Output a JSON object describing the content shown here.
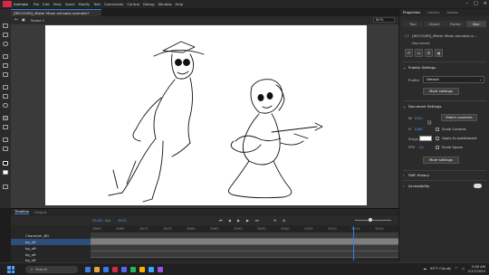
{
  "menubar": {
    "app_name": "Animate",
    "items": [
      "File",
      "Edit",
      "View",
      "Insert",
      "Modify",
      "Text",
      "Commands",
      "Control",
      "Debug",
      "Window",
      "Help"
    ]
  },
  "document": {
    "tab_title": "[RECOVER]_Mister Moon animatic.animatic*",
    "scene": "Scene 1",
    "zoom": "60%"
  },
  "properties": {
    "panel_title": "Properties",
    "library_tab": "Library",
    "assets_tab": "Assets",
    "tabs": [
      "Tool",
      "Object",
      "Frame",
      "Doc"
    ],
    "active_tab": "Doc",
    "doc_name": "[RECOVER]_Mister Moon animatic.a...",
    "section_document": "Document",
    "publish_settings": "Publish Settings",
    "profile_label": "Profile",
    "profile_value": "Default",
    "more_settings_1": "More settings",
    "document_settings": "Document Settings",
    "width_label": "W",
    "width_value": "1920",
    "height_label": "H",
    "height_value": "1080",
    "match_contents": "Match contents",
    "stage_label": "Stage",
    "scale_content": "Scale Content",
    "apply_pasteboard": "Apply to pasteboard",
    "fps_label": "FPS",
    "fps_value": "24",
    "scale_spans": "Scale Spans",
    "more_settings_2": "More settings",
    "swf_history": "SWF History",
    "accessibility": "Accessibility"
  },
  "timeline": {
    "tabs": [
      "Timeline",
      "Output"
    ],
    "active_tab": "Timeline",
    "fps": "24.00",
    "frame": "3912",
    "ruler_labels": [
      "3860",
      "3865",
      "3870",
      "3875",
      "3880",
      "3885",
      "3890",
      "3895",
      "3900",
      "3905",
      "3910",
      "3915",
      "3920"
    ],
    "layers": [
      "Character_BG",
      "bg_oft",
      "bg_oft",
      "bg_oft",
      "bg_oft"
    ]
  },
  "taskbar": {
    "search_placeholder": "Search",
    "weather": "65°F  Cloudy",
    "time": "3:08 AM",
    "date": "2/17/2024"
  },
  "colors": {
    "accent": "#2f7de8",
    "app_logo": "#d42a4a",
    "stage": "#ffffff"
  }
}
